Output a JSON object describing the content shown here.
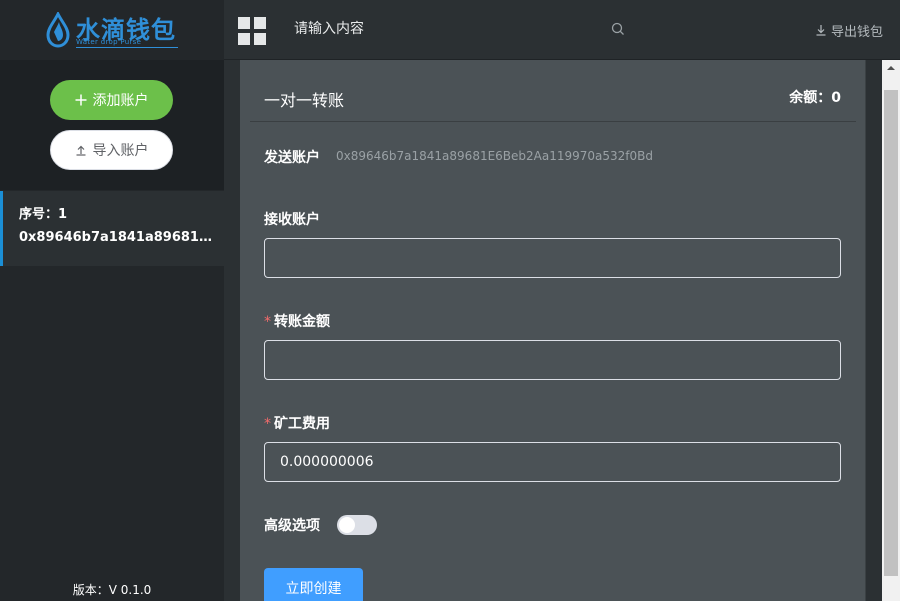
{
  "header": {
    "logo_title": "水滴钱包",
    "logo_subtitle": "Water drop Purse",
    "search_placeholder": "请输入内容",
    "export_label": "导出钱包"
  },
  "sidebar": {
    "add_account_label": "添加账户",
    "import_account_label": "导入账户",
    "accounts": [
      {
        "index_label": "序号：1",
        "address": "0x89646b7a1841a89681E6..."
      }
    ],
    "version": "版本：V 0.1.0"
  },
  "transfer": {
    "title": "一对一转账",
    "balance": "余额：0",
    "send_label": "发送账户",
    "send_address": "0x89646b7a1841a89681E6Beb2Aa119970a532f0Bd",
    "receive_label": "接收账户",
    "receive_value": "",
    "amount_label": "转账金额",
    "amount_value": "",
    "fee_label": "矿工费用",
    "fee_value": "0.000000006",
    "advanced_label": "高级选项",
    "advanced_enabled": false,
    "create_label": "立即创建"
  },
  "colors": {
    "brand_blue": "#2f8fd8",
    "add_green": "#6cc04a",
    "primary_blue": "#409eff",
    "required_red": "#f56c6c",
    "active_border": "#1b8fd6"
  },
  "icons": {
    "logo": "water-drop-icon",
    "menu": "grid-icon",
    "search": "search-icon",
    "export": "download-icon",
    "add": "plus-icon",
    "import": "upload-icon"
  }
}
